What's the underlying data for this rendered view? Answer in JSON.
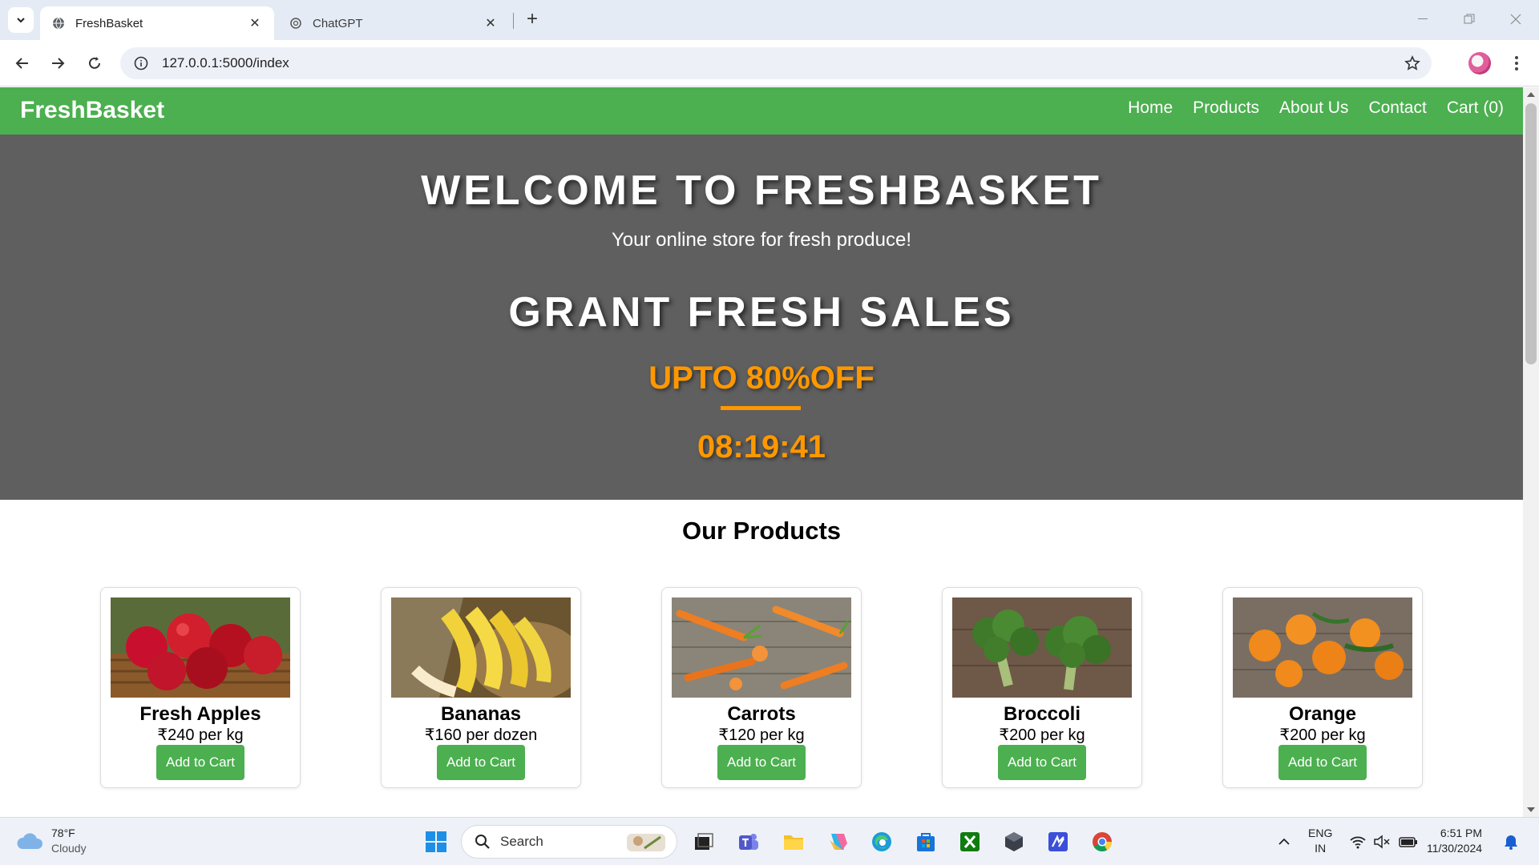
{
  "browser": {
    "tabs": [
      {
        "title": "FreshBasket",
        "active": true
      },
      {
        "title": "ChatGPT",
        "active": false
      }
    ],
    "url": "127.0.0.1:5000/index"
  },
  "site": {
    "brand": "FreshBasket",
    "nav": [
      "Home",
      "Products",
      "About Us",
      "Contact",
      "Cart (0)"
    ],
    "hero": {
      "title": "WELCOME TO FRESHBASKET",
      "tagline": "Your online store for fresh produce!",
      "sale_title": "GRANT FRESH SALES",
      "offer": "UPTO 80%OFF",
      "timer": "08:19:41"
    },
    "products_title": "Our Products",
    "products": [
      {
        "name": "Fresh Apples",
        "price": "₹240 per kg",
        "button": "Add to Cart"
      },
      {
        "name": "Bananas",
        "price": "₹160 per dozen",
        "button": "Add to Cart"
      },
      {
        "name": "Carrots",
        "price": "₹120 per kg",
        "button": "Add to Cart"
      },
      {
        "name": "Broccoli",
        "price": "₹200 per kg",
        "button": "Add to Cart"
      },
      {
        "name": "Orange",
        "price": "₹200 per kg",
        "button": "Add to Cart"
      }
    ]
  },
  "taskbar": {
    "weather_temp": "78°F",
    "weather_cond": "Cloudy",
    "search_label": "Search",
    "lang_top": "ENG",
    "lang_bottom": "IN",
    "time": "6:51 PM",
    "date": "11/30/2024"
  },
  "colors": {
    "brand_green": "#4caf50",
    "hero_bg": "#5f5f5f",
    "accent_orange": "#ff9800"
  }
}
